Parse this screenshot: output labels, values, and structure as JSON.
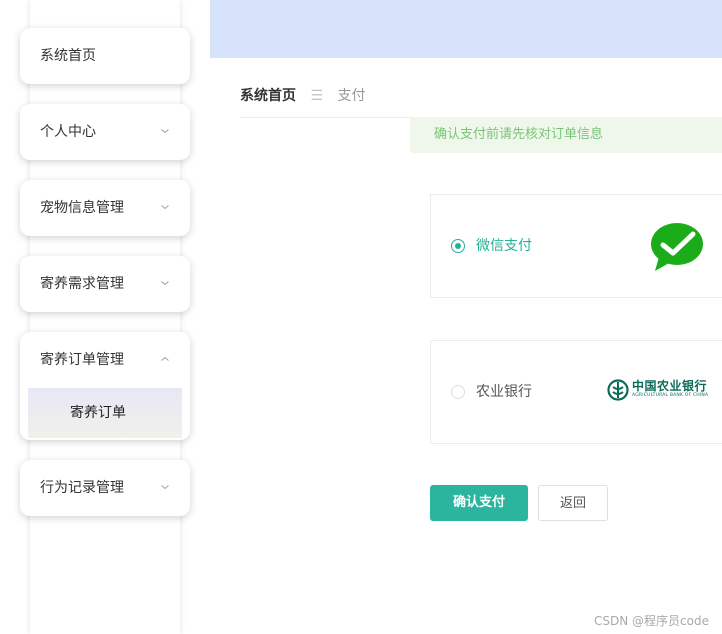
{
  "sidebar": {
    "items": [
      {
        "label": "系统首页"
      },
      {
        "label": "个人中心"
      },
      {
        "label": "宠物信息管理"
      },
      {
        "label": "寄养需求管理"
      },
      {
        "label": "寄养订单管理",
        "subitems": [
          {
            "label": "寄养订单"
          }
        ]
      },
      {
        "label": "行为记录管理"
      }
    ]
  },
  "breadcrumb": {
    "home": "系统首页",
    "separator": "☰",
    "current": "支付"
  },
  "notice": {
    "text": "确认支付前请先核对订单信息"
  },
  "payment": {
    "options": [
      {
        "label": "微信支付",
        "selected": true,
        "logo": "wechat-logo"
      },
      {
        "label": "农业银行",
        "selected": false,
        "logo": "abc-bank-logo",
        "logo_text_cn": "中国农业银行",
        "logo_text_en": "AGRICULTURAL BANK OF CHINA"
      }
    ]
  },
  "actions": {
    "confirm_label": "确认支付",
    "back_label": "返回"
  },
  "watermark": {
    "text": "CSDN @程序员code"
  },
  "colors": {
    "accent": "#2bb59e",
    "banner": "#d7e2fb",
    "notice_bg": "#eef7ea",
    "notice_text": "#7ac47a",
    "wechat_green": "#1aad19",
    "abc_green": "#0b6b5a"
  }
}
